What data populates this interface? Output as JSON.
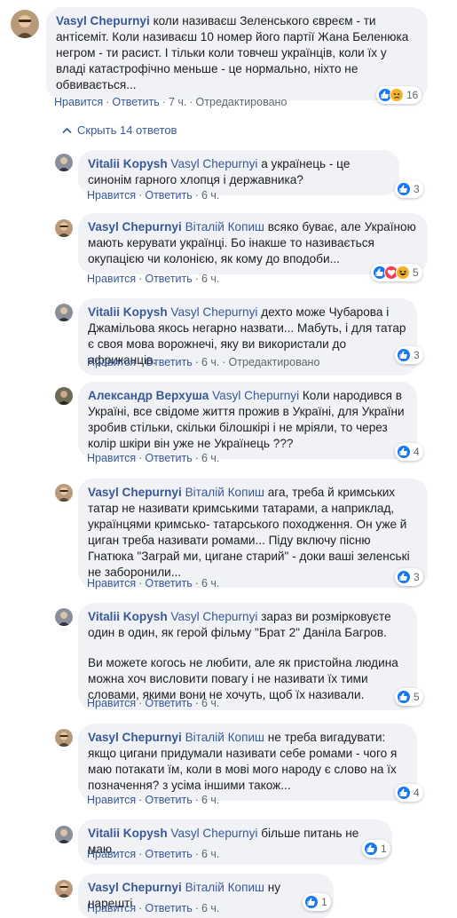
{
  "labels": {
    "like": "Нравится",
    "reply": "Ответить",
    "edited": "Отредактировано",
    "sep": "·"
  },
  "top_comment": {
    "author": "Vasyl Chepurnyi",
    "text": "коли називаєш Зеленського євреєм - ти антісеміт. Коли називаєш 10 номер його партії Жана Беленюка негром - ти расист. І тільки коли товчеш українців, коли їх у владі катастрофічно меньше - це нормально, ніхто не обвивається...",
    "time": "7 ч.",
    "reactions": {
      "icons": [
        "like",
        "sad"
      ],
      "count": "16"
    }
  },
  "hide_replies": "Скрыть 14 ответов",
  "replies": [
    {
      "author": "Vitalii Kopysh",
      "tag": "Vasyl Chepurnyi",
      "text": "а українець - це синонім гарного хлопця і державника?",
      "time": "6 ч.",
      "edited": false,
      "reactions": {
        "icons": [
          "like"
        ],
        "count": "3"
      }
    },
    {
      "author": "Vasyl Chepurnyi",
      "tag": "Віталій Копиш",
      "text": "всяко буває, але Україною мають керувати українці. Бо інакше то називається окупацією чи колонією, як кому до вподоби...",
      "time": "6 ч.",
      "edited": false,
      "reactions": {
        "icons": [
          "like",
          "love",
          "haha"
        ],
        "count": "5"
      }
    },
    {
      "author": "Vitalii Kopysh",
      "tag": "Vasyl Chepurnyi",
      "text": "дехто може Чубарова і Джамільова якось негарно назвати... Мабуть, і для татар є своя мова ворожнечі, яку ви використали до африканців.",
      "time": "6 ч.",
      "edited": true,
      "reactions": {
        "icons": [
          "like"
        ],
        "count": "3"
      }
    },
    {
      "author": "Александр Верхуша",
      "tag": "Vasyl Chepurnyi",
      "text": "Коли народився в Україні, все свідоме життя прожив в Україні, для України зробив стільки, скільки білошкірі і не мріяли, то через колір шкіри він уже не Українець ???",
      "time": "6 ч.",
      "edited": false,
      "reactions": {
        "icons": [
          "like"
        ],
        "count": "4"
      }
    },
    {
      "author": "Vasyl Chepurnyi",
      "tag": "Віталій Копиш",
      "text": "ага, треба й кримських татар не називати кримськими татарами, а наприклад, українцями кримсько- татарського походження. Он уже й циган треба називати ромами... Піду включу пісню Гнатюка \"Заграй ми, цигане старий\" - доки ваші зеленські не заборонили...",
      "time": "6 ч.",
      "edited": false,
      "reactions": {
        "icons": [
          "like"
        ],
        "count": "3"
      }
    },
    {
      "author": "Vitalii Kopysh",
      "tag": "Vasyl Chepurnyi",
      "text": "зараз ви розмірковуєте один в один, як герой фільму \"Брат 2\" Даніла Багров.",
      "text2": "Ви можете когось не любити, але як пристойна людина можна хоч висловити повагу і не називати їх тими словами, якими вони не хочуть, щоб їх називали.",
      "time": "6 ч.",
      "edited": false,
      "reactions": {
        "icons": [
          "like"
        ],
        "count": "5"
      }
    },
    {
      "author": "Vasyl Chepurnyi",
      "tag": "Віталій Копиш",
      "text": "не треба вигадувати: якщо цигани придумали називати себе ромами - чого я маю потакати їм, коли в мові мого народу є слово на їх позначення? з усіма іншими також...",
      "time": "6 ч.",
      "edited": false,
      "reactions": {
        "icons": [
          "like"
        ],
        "count": "4"
      }
    },
    {
      "author": "Vitalii Kopysh",
      "tag": "Vasyl Chepurnyi",
      "text": "більше питань не маю.",
      "time": "6 ч.",
      "edited": false,
      "reactions": {
        "icons": [
          "like"
        ],
        "count": "1"
      }
    },
    {
      "author": "Vasyl Chepurnyi",
      "tag": "Віталій Копиш",
      "text": "ну нарешті",
      "time": "6 ч.",
      "edited": false,
      "reactions": {
        "icons": [
          "like"
        ],
        "count": "1"
      }
    }
  ]
}
